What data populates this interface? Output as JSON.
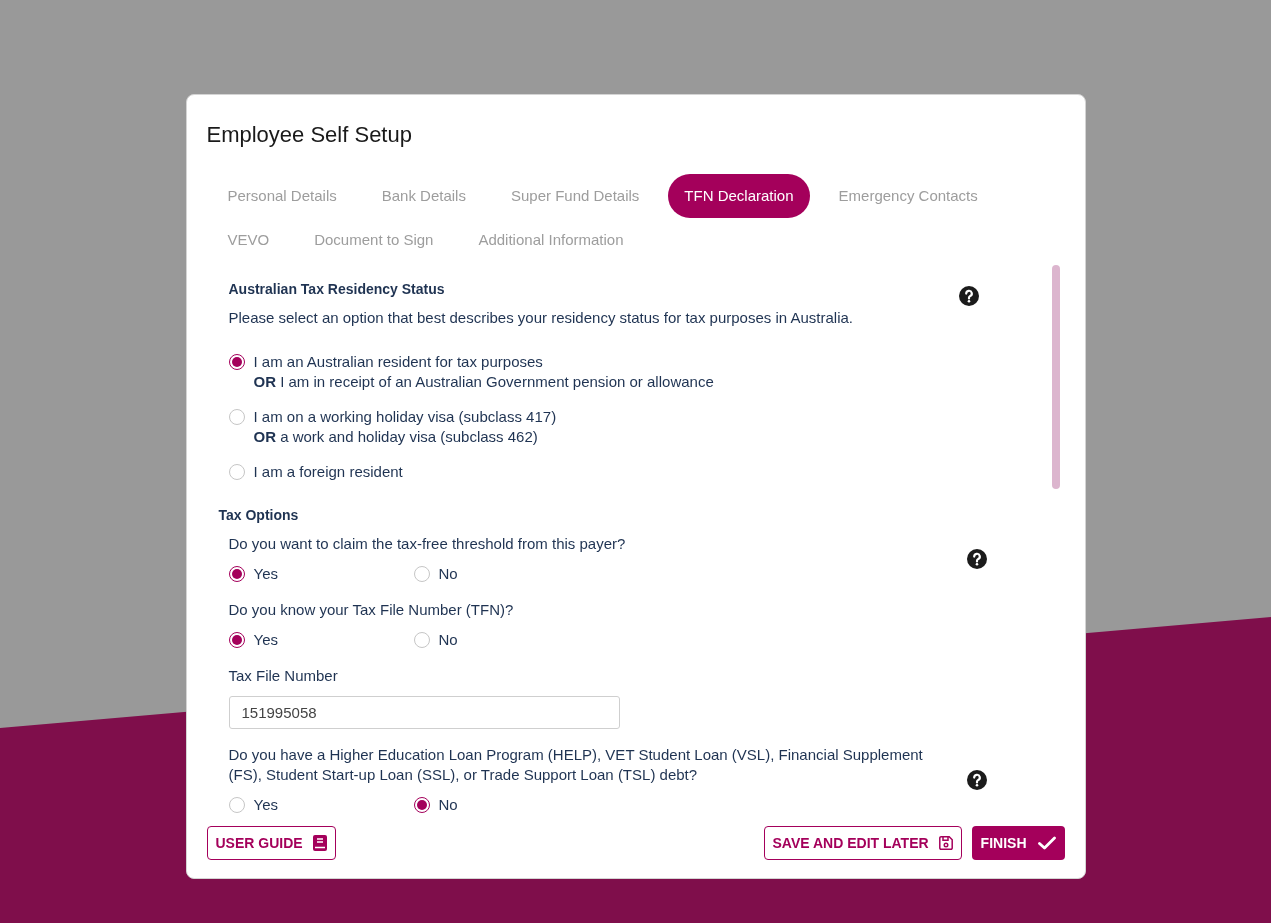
{
  "dialog": {
    "title": "Employee Self Setup"
  },
  "tabs": [
    {
      "label": "Personal Details",
      "selected": false
    },
    {
      "label": "Bank Details",
      "selected": false
    },
    {
      "label": "Super Fund Details",
      "selected": false
    },
    {
      "label": "TFN Declaration",
      "selected": true
    },
    {
      "label": "Emergency Contacts",
      "selected": false
    },
    {
      "label": "VEVO",
      "selected": false
    },
    {
      "label": "Document to Sign",
      "selected": false
    },
    {
      "label": "Additional Information",
      "selected": false
    }
  ],
  "residency": {
    "heading": "Australian Tax Residency Status",
    "description": "Please select an option that best describes your residency status for tax purposes in Australia.",
    "help": true,
    "options": [
      {
        "label": "I am an Australian resident for tax purposes",
        "note": "**OR** I am in receipt of an Australian Government pension or allowance",
        "selected": true
      },
      {
        "label": "I am on a working holiday visa (subclass 417)",
        "note": "**OR** a work and holiday visa (subclass 462)",
        "selected": false
      },
      {
        "label": "I am a foreign resident",
        "selected": false
      }
    ]
  },
  "tax_options": {
    "heading": "Tax Options",
    "fields": [
      {
        "kind": "choice",
        "question": "Do you want to claim the tax-free threshold from this payer?",
        "help": true,
        "options": [
          {
            "label": "Yes",
            "selected": true
          },
          {
            "label": "No",
            "selected": false
          }
        ]
      },
      {
        "kind": "choice",
        "question": "Do you know your Tax File Number (TFN)?",
        "help": false,
        "options": [
          {
            "label": "Yes",
            "selected": true
          },
          {
            "label": "No",
            "selected": false
          }
        ]
      },
      {
        "kind": "text",
        "label": "Tax File Number",
        "value": "151995058",
        "help": false
      },
      {
        "kind": "choice",
        "question": "Do you have a Higher Education Loan Program (HELP), VET Student Loan (VSL), Financial Supplement (FS), Student Start-up Loan (SSL), or Trade Support Loan (TSL) debt?",
        "help": true,
        "options": [
          {
            "label": "Yes",
            "selected": false
          },
          {
            "label": "No",
            "selected": true
          }
        ]
      }
    ]
  },
  "footer": {
    "left_buttons": [
      {
        "label": "USER GUIDE",
        "kind": "guide"
      }
    ],
    "right_buttons": [
      {
        "label": "SAVE AND EDIT LATER",
        "kind": "save"
      },
      {
        "label": "FINISH",
        "kind": "finish"
      }
    ]
  }
}
